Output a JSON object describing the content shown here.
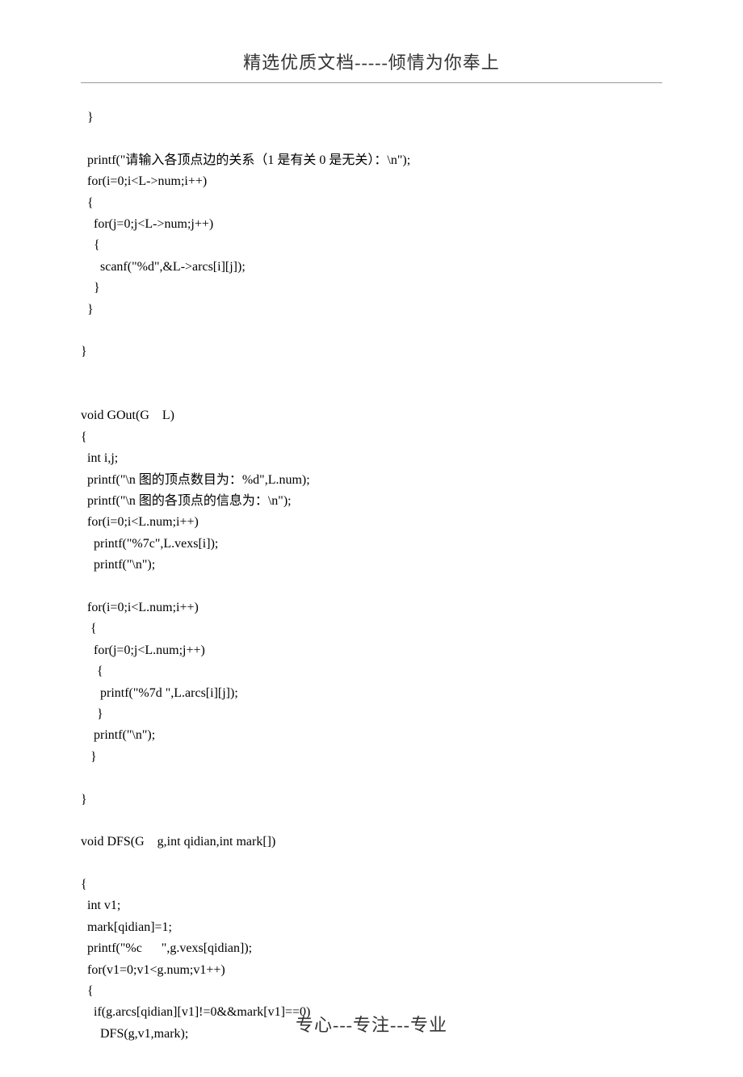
{
  "header": "精选优质文档-----倾情为你奉上",
  "footer": "专心---专注---专业",
  "code_lines": [
    "  }",
    "",
    "  printf(\"请输入各顶点边的关系（1 是有关 0 是无关）：\\n\");",
    "  for(i=0;i<L->num;i++)",
    "  {",
    "    for(j=0;j<L->num;j++)",
    "    {",
    "      scanf(\"%d\",&L->arcs[i][j]);",
    "    }",
    "  }",
    "",
    "}",
    "",
    "",
    "void GOut(G    L)",
    "{",
    "  int i,j;",
    "  printf(\"\\n 图的顶点数目为：%d\",L.num);",
    "  printf(\"\\n 图的各顶点的信息为：\\n\");",
    "  for(i=0;i<L.num;i++)",
    "    printf(\"%7c\",L.vexs[i]);",
    "    printf(\"\\n\");",
    "",
    "  for(i=0;i<L.num;i++)",
    "   {",
    "    for(j=0;j<L.num;j++)",
    "     {",
    "      printf(\"%7d \",L.arcs[i][j]);",
    "     }",
    "    printf(\"\\n\");",
    "   }",
    "",
    "}",
    "",
    "void DFS(G    g,int qidian,int mark[])",
    "",
    "{",
    "  int v1;",
    "  mark[qidian]=1;",
    "  printf(\"%c      \",g.vexs[qidian]);",
    "  for(v1=0;v1<g.num;v1++)",
    "  {",
    "    if(g.arcs[qidian][v1]!=0&&mark[v1]==0)",
    "      DFS(g,v1,mark);"
  ]
}
